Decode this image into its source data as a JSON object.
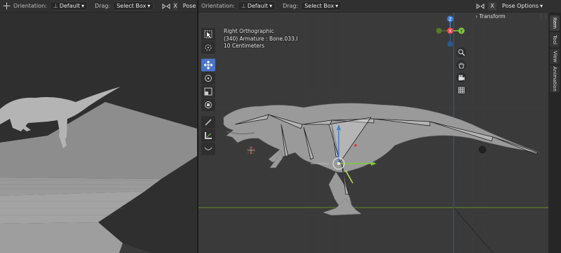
{
  "left_header": {
    "orientation_label": "Orientation:",
    "orientation_value": "Default",
    "drag_label": "Drag:",
    "drag_value": "Select Box",
    "x_label": "X",
    "pose_options": "Pose Options"
  },
  "right_header": {
    "orientation_label": "Orientation:",
    "orientation_value": "Default",
    "drag_label": "Drag:",
    "drag_value": "Select Box",
    "x_label": "X",
    "pose_options": "Pose Options"
  },
  "overlay": {
    "view_name": "Right Orthographic",
    "selection": "(340) Armature : Bone.033.l",
    "scale": "10 Centimeters"
  },
  "gizmo": {
    "z": "Z",
    "x": "X",
    "y": "Y"
  },
  "sidebar": {
    "transform_label": "Transform",
    "tabs": [
      "Item",
      "Tool",
      "View",
      "Animation"
    ]
  },
  "toolbar": {
    "tools": [
      "select-box",
      "cursor",
      "move",
      "rotate",
      "scale",
      "transform",
      "annotate",
      "measure",
      "relax"
    ],
    "active_tool": "move"
  },
  "colors": {
    "active": "#4a74c9",
    "axis_x": "#e8494f",
    "axis_y": "#7fc63a",
    "axis_z": "#3f82d9",
    "horizon": "#6b8a2a"
  }
}
